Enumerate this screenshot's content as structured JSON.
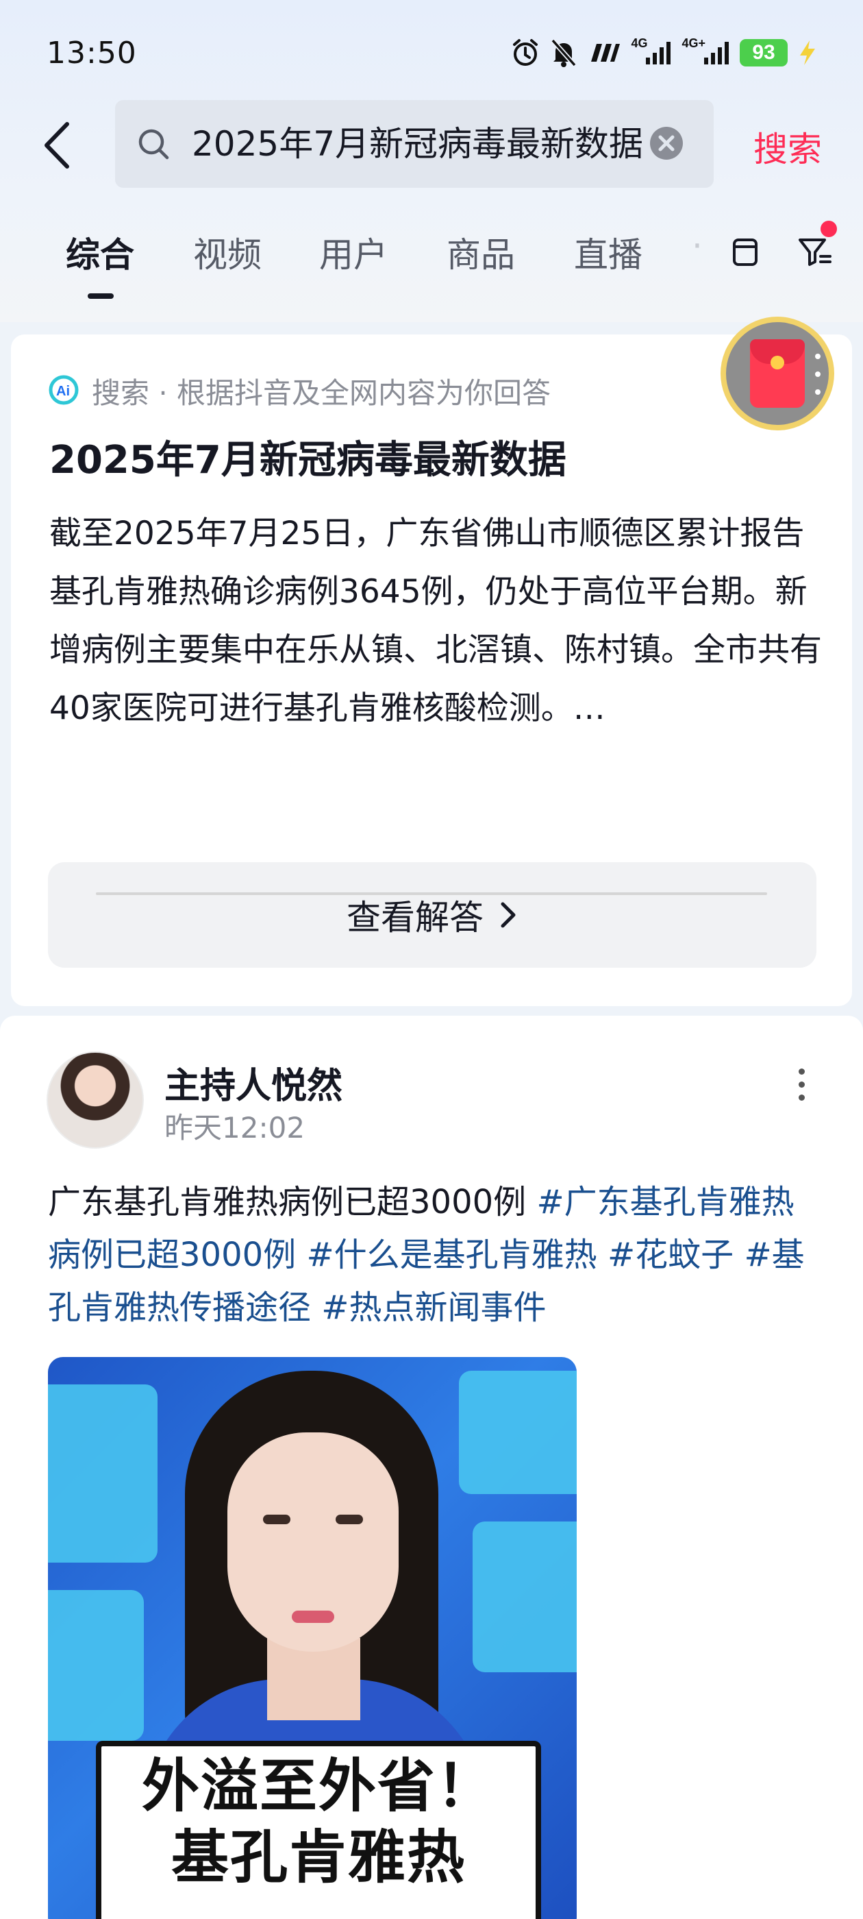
{
  "status_bar": {
    "time": "13:50",
    "network_1": "4G",
    "network_2": "4G+",
    "battery": "93"
  },
  "search": {
    "query": "2025年7月新冠病毒最新数据",
    "button": "搜索"
  },
  "tabs": [
    {
      "label": "综合",
      "active": true
    },
    {
      "label": "视频",
      "active": false
    },
    {
      "label": "用户",
      "active": false
    },
    {
      "label": "商品",
      "active": false
    },
    {
      "label": "直播",
      "active": false
    }
  ],
  "ai_card": {
    "source": "搜索 · 根据抖音及全网内容为你回答",
    "title": "2025年7月新冠病毒最新数据",
    "body": "截至2025年7月25日，广东省佛山市顺德区累计报告基孔肯雅热确诊病例3645例，仍处于高位平台期。新增病例主要集中在乐从镇、北滘镇、陈村镇。全市共有40家医院可进行基孔肯雅核酸检测。…",
    "button": "查看解答"
  },
  "post": {
    "author": "主持人悦然",
    "time": "昨天12:02",
    "text": "广东基孔肯雅热病例已超3000例",
    "hashtags": [
      "#广东基孔肯雅热病例已超3000例",
      "#什么是基孔肯雅热",
      "#花蚊子",
      "#基孔肯雅热传播途径",
      "#热点新闻事件"
    ],
    "video_caption_line1": "外溢至外省！",
    "video_caption_line2": "基孔肯雅热"
  }
}
